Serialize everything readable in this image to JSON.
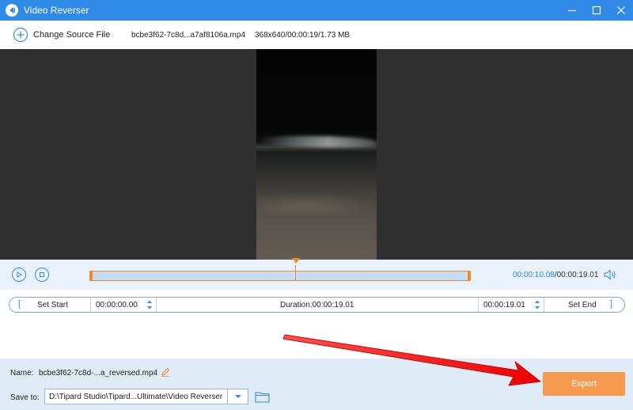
{
  "window": {
    "title": "Video Reverser",
    "accent_color": "#2f8ae8",
    "controls": [
      "minimize-icon",
      "maximize-icon",
      "close-icon"
    ]
  },
  "source": {
    "change_label": "Change Source File",
    "file_name": "bcbe3f62-7c8d...a7af8106a.mp4",
    "file_meta": "368x640/00:00:19/1.73 MB"
  },
  "player": {
    "current_time": "00:00:10.08",
    "total_time": "/00:00:19.01",
    "timeline_position": 0.54,
    "play_icon": "play-icon",
    "stop_icon": "stop-icon",
    "volume_icon": "volume-icon"
  },
  "trim": {
    "set_start_label": "Set Start",
    "start_value": "00:00:00.00",
    "duration_label": "Duration:00:00:19.01",
    "end_value": "00:00:19.01",
    "set_end_label": "Set End"
  },
  "output": {
    "name_label": "Name:",
    "name_value": "bcbe3f62-7c8d-...a_reversed.mp4",
    "save_label": "Save to:",
    "save_path": "D:\\Tipard Studio\\Tipard...Ultimate\\Video Reverser",
    "export_label": "Export",
    "export_color": "#f59a4e"
  },
  "annotation": {
    "arrow_color": "#ff1a1a"
  }
}
